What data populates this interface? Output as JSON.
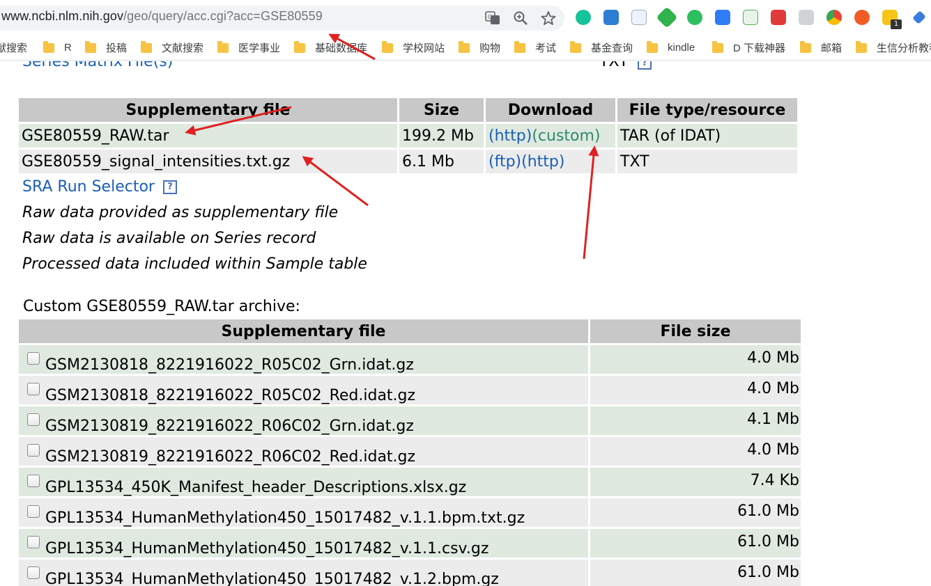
{
  "browser": {
    "url_host": "www.ncbi.nlm.nih.gov",
    "url_path": "/geo/query/acc.cgi?acc=GSE80559",
    "bookmarks": [
      "献搜索",
      "R",
      "投稿",
      "文献搜索",
      "医学事业",
      "基础数据库",
      "学校网站",
      "购物",
      "考试",
      "基金查询",
      "kindle",
      "D 下载神器",
      "邮箱",
      "生信分析教程"
    ],
    "extension_badge": "1"
  },
  "series_matrix": {
    "label": "Series Matrix File(s)",
    "type": "TXT"
  },
  "supplementary": {
    "headers": [
      "Supplementary file",
      "Size",
      "Download",
      "File type/resource"
    ],
    "rows": [
      {
        "file": "GSE80559_RAW.tar",
        "size": "199.2 Mb",
        "link1": "(http)",
        "link2": "(custom)",
        "type": "TAR (of IDAT)"
      },
      {
        "file": "GSE80559_signal_intensities.txt.gz",
        "size": "6.1 Mb",
        "link1": "(ftp)",
        "link2": "(http)",
        "type": "TXT"
      }
    ]
  },
  "sra_run_selector": "SRA Run Selector",
  "help_glyph": "?",
  "notes": [
    "Raw data provided as supplementary file",
    "Raw data is available on Series record",
    "Processed data included within Sample table"
  ],
  "archive": {
    "title": "Custom GSE80559_RAW.tar archive:",
    "headers": [
      "Supplementary file",
      "File size"
    ],
    "rows": [
      {
        "file": "GSM2130818_8221916022_R05C02_Grn.idat.gz",
        "size": "4.0 Mb"
      },
      {
        "file": "GSM2130818_8221916022_R05C02_Red.idat.gz",
        "size": "4.0 Mb"
      },
      {
        "file": "GSM2130819_8221916022_R06C02_Grn.idat.gz",
        "size": "4.1 Mb"
      },
      {
        "file": "GSM2130819_8221916022_R06C02_Red.idat.gz",
        "size": "4.0 Mb"
      },
      {
        "file": "GPL13534_450K_Manifest_header_Descriptions.xlsx.gz",
        "size": "7.4 Kb"
      },
      {
        "file": "GPL13534_HumanMethylation450_15017482_v.1.1.bpm.txt.gz",
        "size": "61.0 Mb"
      },
      {
        "file": "GPL13534_HumanMethylation450_15017482_v.1.1.csv.gz",
        "size": "61.0 Mb"
      },
      {
        "file": "GPL13534_HumanMethylation450_15017482_v.1.2.bpm.gz",
        "size": "61.0 Mb"
      }
    ]
  },
  "colors": {
    "link": "#1a5fb4",
    "visited": "#2c8a6e",
    "row_green": "#dfe9df",
    "row_gray": "#ececec",
    "header_bg": "#c8c8c8",
    "annotation_arrow": "#e02020"
  }
}
